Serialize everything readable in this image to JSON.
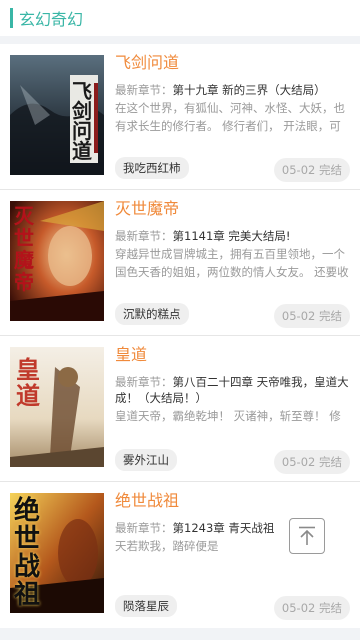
{
  "header": {
    "title": "玄幻奇幻"
  },
  "books": [
    {
      "title": "飞剑问道",
      "chapter_label": "最新章节：",
      "chapter": "第十九章 新的三界（大结局）",
      "desc": "在这个世界，有狐仙、河神、水怪、大妖，也有求长生的修行者。 修行者们， 开法眼，可看",
      "author": "我吃西红柿",
      "update": "05-02 完结",
      "cover_text": "飞剑问道",
      "cover_sub": "我吃西红柿"
    },
    {
      "title": "灭世魔帝",
      "chapter_label": "最新章节：",
      "chapter": "第1141章 完美大结局!",
      "desc": "穿越异世成冒牌城主，拥有五百里领地，一个国色天香的姐姐，两位数的情人女友。 还要收获",
      "author": "沉默的糕点",
      "update": "05-02 完结",
      "cover_text": "灭世魔帝",
      "cover_sub": "沉默的糕点"
    },
    {
      "title": "皇道",
      "chapter_label": "最新章节：",
      "chapter": "第八百二十四章 天帝唯我，皇道大成！（大结局！）",
      "desc": "皇道天帝，霸绝乾坤！ 灭诸神，斩至尊！ 修我皇道",
      "author": "雾外江山",
      "update": "05-02 完结",
      "cover_text": "皇道",
      "cover_sub": "雾外江山"
    },
    {
      "title": "绝世战祖",
      "chapter_label": "最新章节：",
      "chapter": "第1243章 青天战祖",
      "desc": "天若欺我，踏碎便是",
      "author": "陨落星辰",
      "update": "05-02 完结",
      "cover_text": "绝世战祖",
      "cover_sub": ""
    }
  ],
  "back_to_top": {
    "icon": "arrow-up-to-top-icon"
  },
  "colors": {
    "accent": "#39b6a6",
    "title": "#f08a3b"
  }
}
